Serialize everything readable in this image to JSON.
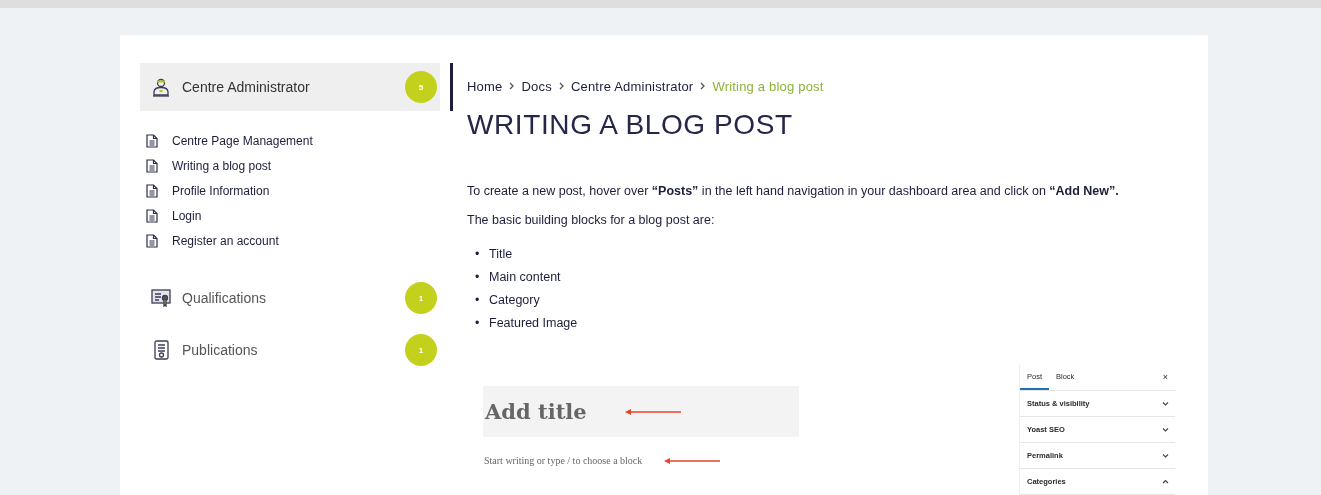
{
  "sidebar": {
    "sections": [
      {
        "label": "Centre Administrator",
        "badge": "5",
        "selected": true,
        "children": [
          {
            "label": "Centre Page Management"
          },
          {
            "label": "Writing a blog post"
          },
          {
            "label": "Profile Information"
          },
          {
            "label": "Login"
          },
          {
            "label": "Register an account"
          }
        ]
      },
      {
        "label": "Qualifications",
        "badge": "1",
        "selected": false
      },
      {
        "label": "Publications",
        "badge": "1",
        "selected": false
      }
    ]
  },
  "breadcrumb": [
    {
      "label": "Home",
      "current": false
    },
    {
      "label": "Docs",
      "current": false
    },
    {
      "label": "Centre Administrator",
      "current": false
    },
    {
      "label": "Writing a blog post",
      "current": true
    }
  ],
  "heading": "WRITING A BLOG POST",
  "paragraphs": [
    "To create a new post, hover over **“Posts”** in the left hand navigation in your dashboard area and click on **“Add New”.**",
    "The basic building blocks for a blog post are:"
  ],
  "bullets": [
    {
      "marker": "•",
      "text": "Title"
    },
    {
      "marker": "•",
      "text": "Main content"
    },
    {
      "marker": "•",
      "text": "Category"
    },
    {
      "marker": "•",
      "text": "Featured Image"
    }
  ],
  "editor_screenshot": {
    "title_placeholder": "Add title",
    "body_placeholder": "Start writing or type / to choose a block",
    "settings_panel": {
      "tabs": [
        {
          "label": "Post",
          "selected": true
        },
        {
          "label": "Block",
          "selected": false
        }
      ],
      "close": "×",
      "panels": [
        {
          "label": "Status & visibility",
          "expanded": false
        },
        {
          "label": "Yoast SEO",
          "expanded": false
        },
        {
          "label": "Permalink",
          "expanded": false
        },
        {
          "label": "Categories",
          "expanded": true
        }
      ]
    }
  }
}
